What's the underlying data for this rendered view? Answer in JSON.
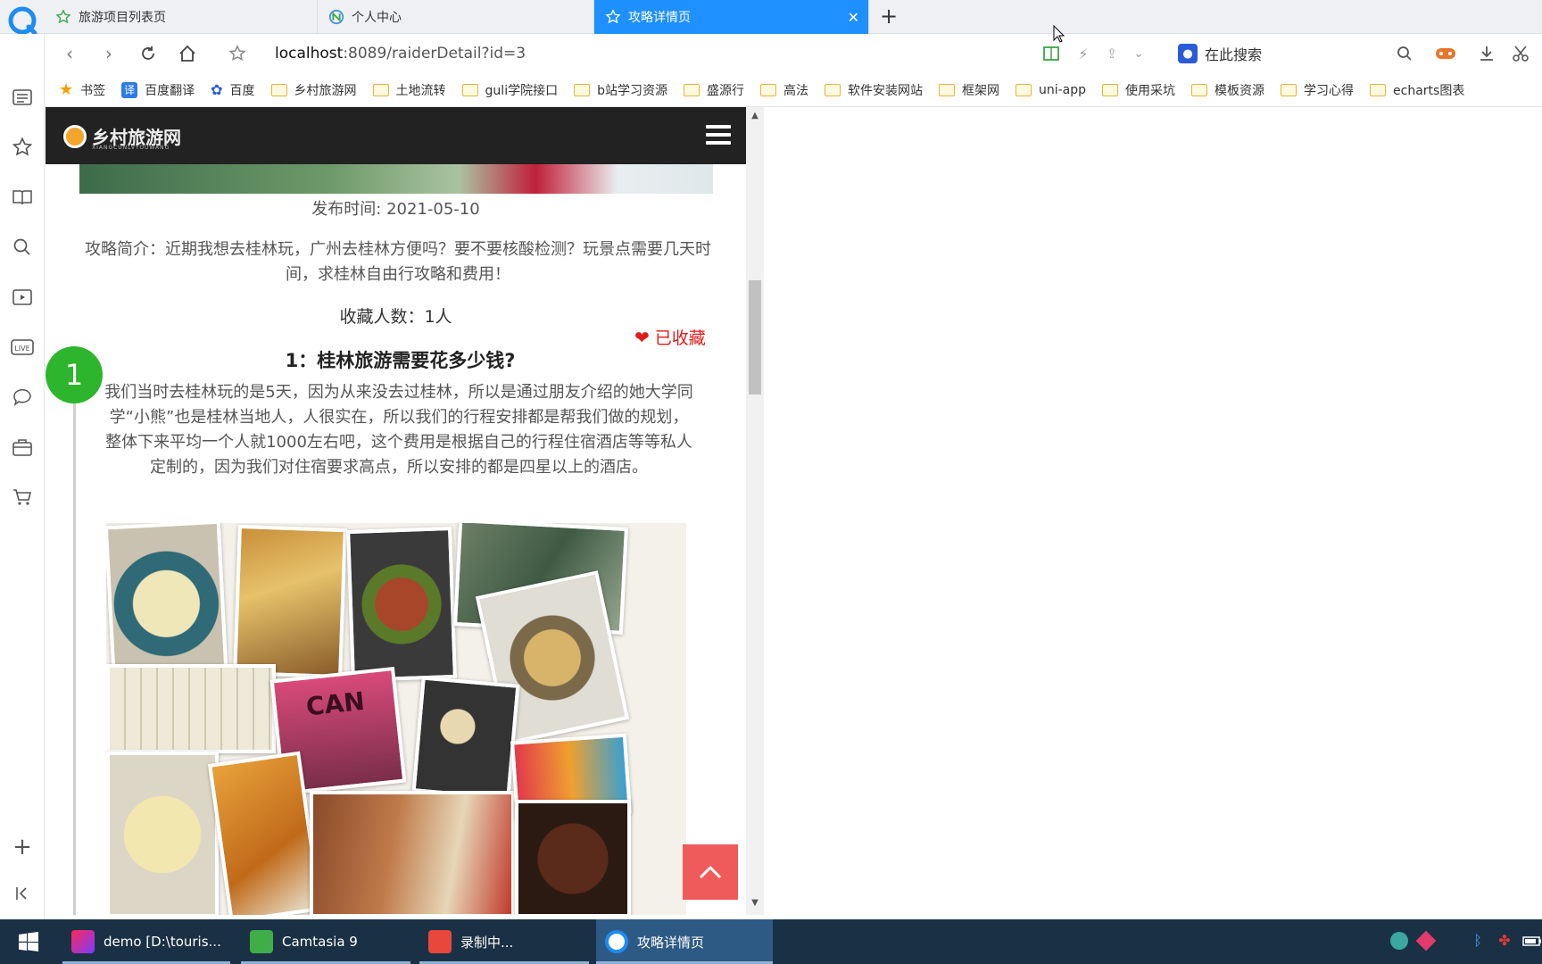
{
  "browser": {
    "tabs": [
      {
        "label": "旅游项目列表页",
        "active": false
      },
      {
        "label": "个人中心",
        "active": false
      },
      {
        "label": "攻略详情页",
        "active": true
      }
    ],
    "new_tab": "+",
    "url_host": "localhost",
    "url_path": ":8089/raiderDetail?id=3",
    "search_placeholder": "在此搜索",
    "bookmarks": [
      "书签",
      "百度翻译",
      "百度",
      "乡村旅游网",
      "土地流转",
      "guli学院接口",
      "b站学习资源",
      "盛源行",
      "高法",
      "软件安装网站",
      "框架网",
      "uni-app",
      "使用采坑",
      "模板资源",
      "学习心得",
      "echarts图表"
    ]
  },
  "site": {
    "logo_name": "乡村旅游网",
    "logo_sub": "XIANGCUNLVYOUWANG"
  },
  "article": {
    "publish_time": "发布时间: 2021-05-10",
    "summary": "攻略简介：近期我想去桂林玩，广州去桂林方便吗？要不要核酸检测？玩景点需要几天时间，求桂林自由行攻略和费用！",
    "fav_count": "收藏人数：1人",
    "fav_status": "已收藏",
    "step_number": "1",
    "step_title": "1：桂林旅游需要花多少钱?",
    "step_text": "我们当时去桂林玩的是5天，因为从来没去过桂林，所以是通过朋友介绍的她大学同学“小熊”也是桂林当地人，人很实在，所以我们的行程安排都是帮我们做的规划，整体下来平均一个人就1000左右吧，这个费用是根据自己的行程住宿酒店等等私人定制的，因为我们对住宿要求高点，所以安排的都是四星以上的酒店。",
    "collage_text": "CAN"
  },
  "taskbar": {
    "items": [
      "demo [D:\\touris...",
      "Camtasia 9",
      "录制中...",
      "攻略详情页"
    ]
  },
  "colors": {
    "tab_active": "#1e90ff",
    "site_header": "#222222",
    "favorite_red": "#e21b1b",
    "step_badge": "#2db52d",
    "back_to_top": "#ef5a5a",
    "taskbar": "#1a3145"
  }
}
